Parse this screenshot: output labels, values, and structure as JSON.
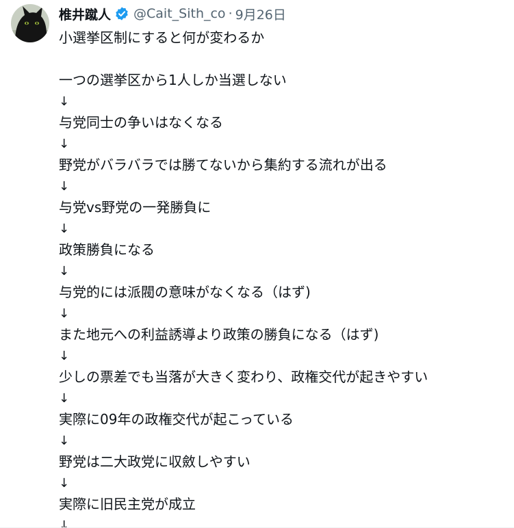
{
  "author": {
    "display_name": "椎井蹴人",
    "handle": "@Cait_Sith_co",
    "separator": "·",
    "date": "9月26日",
    "avatar_icon": "black-cat-avatar",
    "verified_icon": "verified-badge-icon",
    "verified_color": "#1d9bf0"
  },
  "tweet": {
    "line_00": "小選挙区制にすると何が変わるか",
    "line_02": "一つの選挙区から1人しか当選しない",
    "line_03": "↓",
    "line_04": "与党同士の争いはなくなる",
    "line_05": "↓",
    "line_06": "野党がバラバラでは勝てないから集約する流れが出る",
    "line_07": "↓",
    "line_08": "与党vs野党の一発勝負に",
    "line_09": "↓",
    "line_10": "政策勝負になる",
    "line_11": "↓",
    "line_12": "与党的には派閥の意味がなくなる（はず)",
    "line_13": "↓",
    "line_14": "また地元への利益誘導より政策の勝負になる（はず)",
    "line_15": "↓",
    "line_16": "少しの票差でも当落が大きく変わり、政権交代が起きやすい",
    "line_17": "↓",
    "line_18": "実際に09年の政権交代が起こっている",
    "line_19": "↓",
    "line_20": "野党は二大政党に収斂しやすい",
    "line_21": "↓",
    "line_22": "実際に旧民主党が成立",
    "line_23": "↓"
  }
}
